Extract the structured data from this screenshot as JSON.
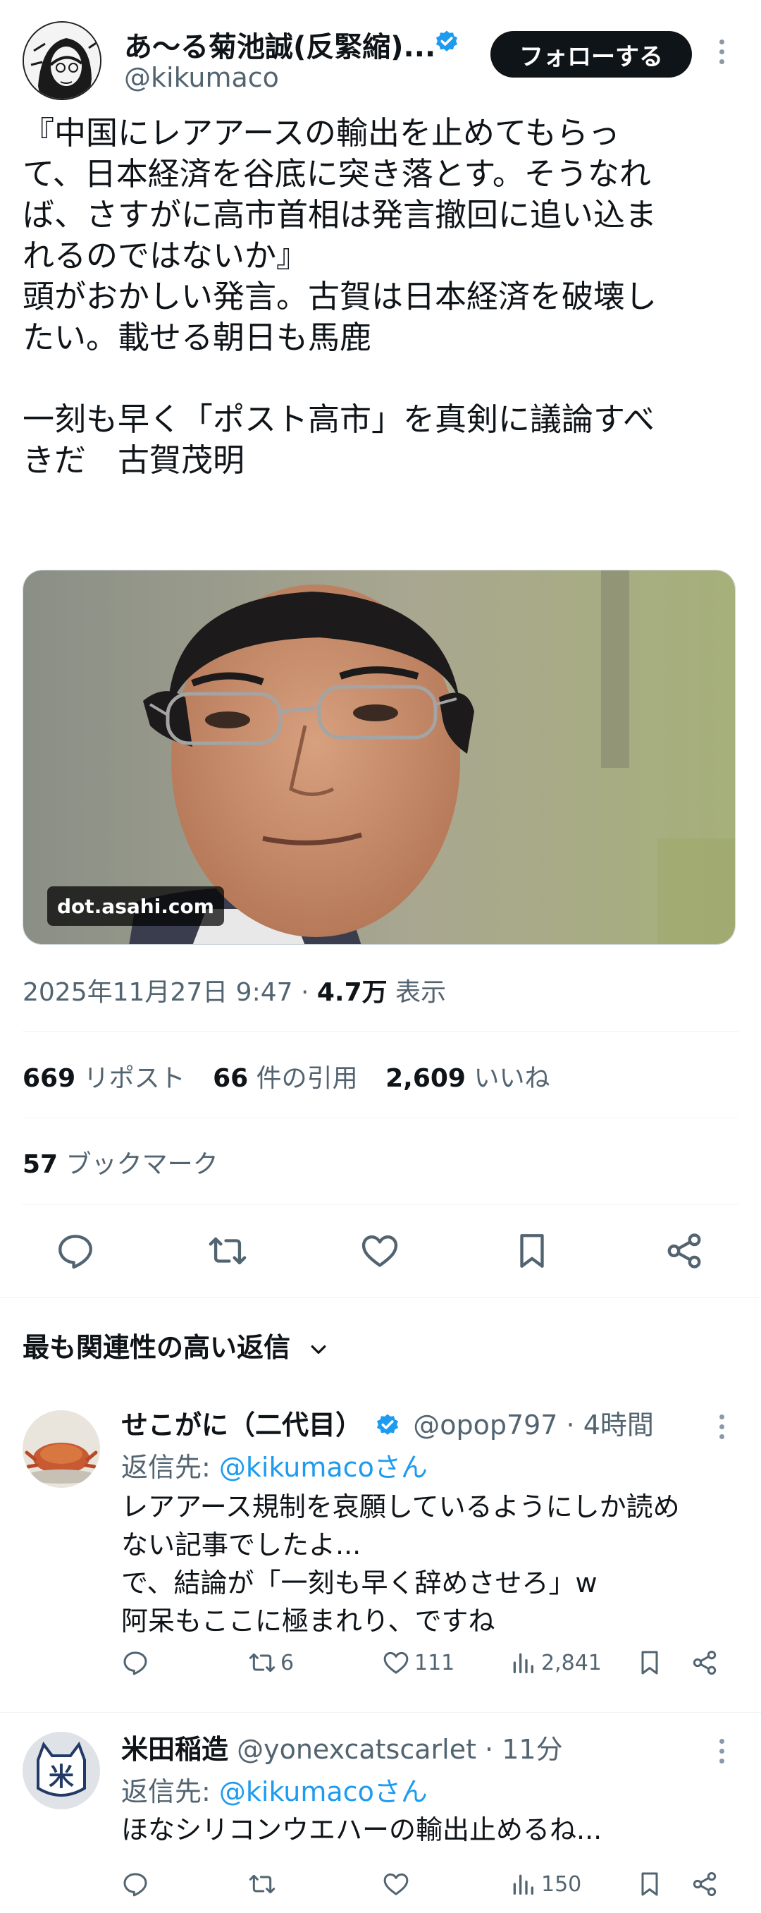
{
  "author": {
    "name": "あ〜る菊池誠(反緊縮)...",
    "handle": "@kikumaco",
    "follow_label": "フォローする"
  },
  "tweet": {
    "lines": [
      "『中国にレアアースの輸出を止めてもらっ",
      "て、日本経済を谷底に突き落とす。そうなれ",
      "ば、さすがに高市首相は発言撤回に追い込ま",
      "れるのではないか』",
      "頭がおかしい発言。古賀は日本経済を破壊し",
      "たい。載せる朝日も馬鹿",
      "",
      "一刻も早く「ポスト高市」を真剣に議論すべ",
      "きだ　古賀茂明"
    ],
    "media_label": "dot.asahi.com",
    "timestamp": "2025年11月27日 9:47",
    "views_value": "4.7万",
    "views_label": "表示"
  },
  "stats": {
    "reposts_value": "669",
    "reposts_label": "リポスト",
    "quotes_value": "66",
    "quotes_label": "件の引用",
    "likes_value": "2,609",
    "likes_label": "いいね",
    "bookmarks_value": "57",
    "bookmarks_label": "ブックマーク"
  },
  "actions": {
    "icons": [
      "reply-icon",
      "repost-icon",
      "like-icon",
      "bookmark-icon",
      "share-icon"
    ]
  },
  "replies_header": "最も関連性の高い返信",
  "replies": [
    {
      "name": "せこがに（二代目）",
      "handle": "@opop797 · 4時間",
      "reply_to_prefix": "返信先: ",
      "reply_to_mention": "@kikumacoさん",
      "lines": [
        "レアアース規制を哀願しているようにしか読め",
        "ない記事でしたよ...",
        "で、結論が「一刻も早く辞めさせろ」w",
        "阿呆もここに極まれり、ですね"
      ],
      "reposts": "6",
      "likes": "111",
      "views": "2,841"
    },
    {
      "name": "米田稲造",
      "handle": "@yonexcatscarlet · 11分",
      "reply_to_prefix": "返信先: ",
      "reply_to_mention": "@kikumacoさん",
      "lines": [
        "ほなシリコンウエハーの輸出止めるね..."
      ],
      "reposts": "",
      "likes": "",
      "views": "150"
    }
  ],
  "colors": {
    "text": "#0f1419",
    "secondary": "#536471",
    "link": "#1d9bf0",
    "verified": "#1d9bf0",
    "follow_bg": "#0f1419"
  }
}
